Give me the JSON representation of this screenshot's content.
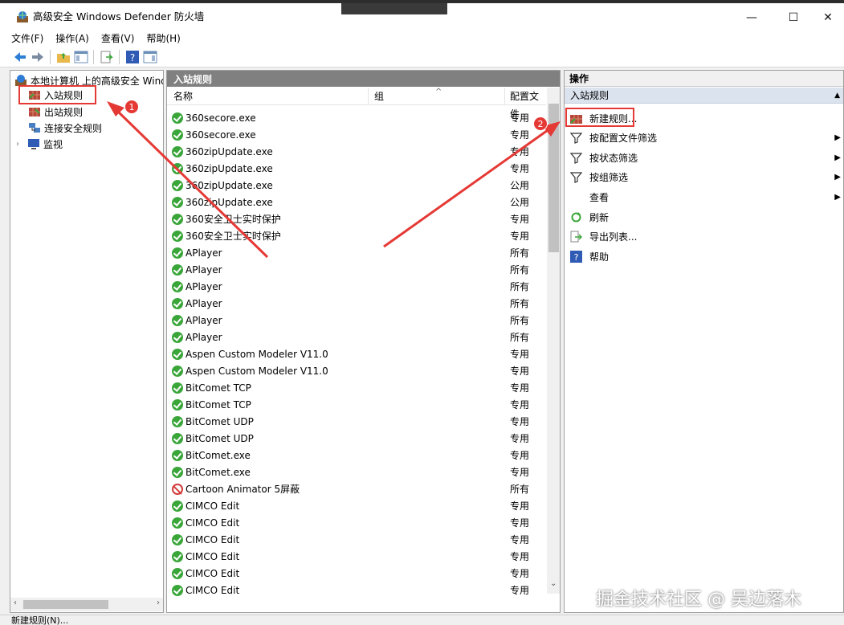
{
  "window": {
    "title": "高级安全 Windows Defender 防火墙",
    "minimize": "—",
    "maximize": "☐",
    "close": "✕"
  },
  "menu": [
    "文件(F)",
    "操作(A)",
    "查看(V)",
    "帮助(H)"
  ],
  "tree": {
    "root": "本地计算机 上的高级安全 Windows Defender 防火墙",
    "items": [
      {
        "label": "入站规则"
      },
      {
        "label": "出站规则"
      },
      {
        "label": "连接安全规则"
      },
      {
        "label": "监视"
      }
    ]
  },
  "middle": {
    "header": "入站规则",
    "columns": {
      "name": "名称",
      "group": "组",
      "profile": "配置文件"
    },
    "rows": [
      {
        "name": "360secore.exe",
        "profile": "专用",
        "status": "allow"
      },
      {
        "name": "360secore.exe",
        "profile": "专用",
        "status": "allow"
      },
      {
        "name": "360zipUpdate.exe",
        "profile": "专用",
        "status": "allow"
      },
      {
        "name": "360zipUpdate.exe",
        "profile": "专用",
        "status": "allow"
      },
      {
        "name": "360zipUpdate.exe",
        "profile": "公用",
        "status": "allow"
      },
      {
        "name": "360zipUpdate.exe",
        "profile": "公用",
        "status": "allow"
      },
      {
        "name": "360安全卫士实时保护",
        "profile": "专用",
        "status": "allow"
      },
      {
        "name": "360安全卫士实时保护",
        "profile": "专用",
        "status": "allow"
      },
      {
        "name": "APlayer",
        "profile": "所有",
        "status": "allow"
      },
      {
        "name": "APlayer",
        "profile": "所有",
        "status": "allow"
      },
      {
        "name": "APlayer",
        "profile": "所有",
        "status": "allow"
      },
      {
        "name": "APlayer",
        "profile": "所有",
        "status": "allow"
      },
      {
        "name": "APlayer",
        "profile": "所有",
        "status": "allow"
      },
      {
        "name": "APlayer",
        "profile": "所有",
        "status": "allow"
      },
      {
        "name": "Aspen Custom Modeler V11.0",
        "profile": "专用",
        "status": "allow"
      },
      {
        "name": "Aspen Custom Modeler V11.0",
        "profile": "专用",
        "status": "allow"
      },
      {
        "name": "BitComet TCP",
        "profile": "专用",
        "status": "allow"
      },
      {
        "name": "BitComet TCP",
        "profile": "专用",
        "status": "allow"
      },
      {
        "name": "BitComet UDP",
        "profile": "专用",
        "status": "allow"
      },
      {
        "name": "BitComet UDP",
        "profile": "专用",
        "status": "allow"
      },
      {
        "name": "BitComet.exe",
        "profile": "专用",
        "status": "allow"
      },
      {
        "name": "BitComet.exe",
        "profile": "专用",
        "status": "allow"
      },
      {
        "name": "Cartoon Animator 5屏蔽",
        "profile": "所有",
        "status": "block"
      },
      {
        "name": "CIMCO Edit",
        "profile": "专用",
        "status": "allow"
      },
      {
        "name": "CIMCO Edit",
        "profile": "专用",
        "status": "allow"
      },
      {
        "name": "CIMCO Edit",
        "profile": "专用",
        "status": "allow"
      },
      {
        "name": "CIMCO Edit",
        "profile": "专用",
        "status": "allow"
      },
      {
        "name": "CIMCO Edit",
        "profile": "专用",
        "status": "allow"
      },
      {
        "name": "CIMCO Edit",
        "profile": "专用",
        "status": "allow"
      }
    ]
  },
  "actions": {
    "header": "操作",
    "section": "入站规则",
    "items": [
      {
        "label": "新建规则...",
        "icon": "new-rule-icon",
        "submenu": false
      },
      {
        "label": "按配置文件筛选",
        "icon": "filter-icon",
        "submenu": true
      },
      {
        "label": "按状态筛选",
        "icon": "filter-icon",
        "submenu": true
      },
      {
        "label": "按组筛选",
        "icon": "filter-icon",
        "submenu": true
      },
      {
        "label": "查看",
        "icon": "",
        "submenu": true
      },
      {
        "label": "刷新",
        "icon": "refresh-icon",
        "submenu": false
      },
      {
        "label": "导出列表...",
        "icon": "export-icon",
        "submenu": false
      },
      {
        "label": "帮助",
        "icon": "help-icon",
        "submenu": false
      }
    ]
  },
  "annotations": {
    "badge1": "1",
    "badge2": "2",
    "accent": "#e53935"
  },
  "status_text": "新建规则(N)...",
  "watermark": "掘金技术社区 @ 吴边落木"
}
